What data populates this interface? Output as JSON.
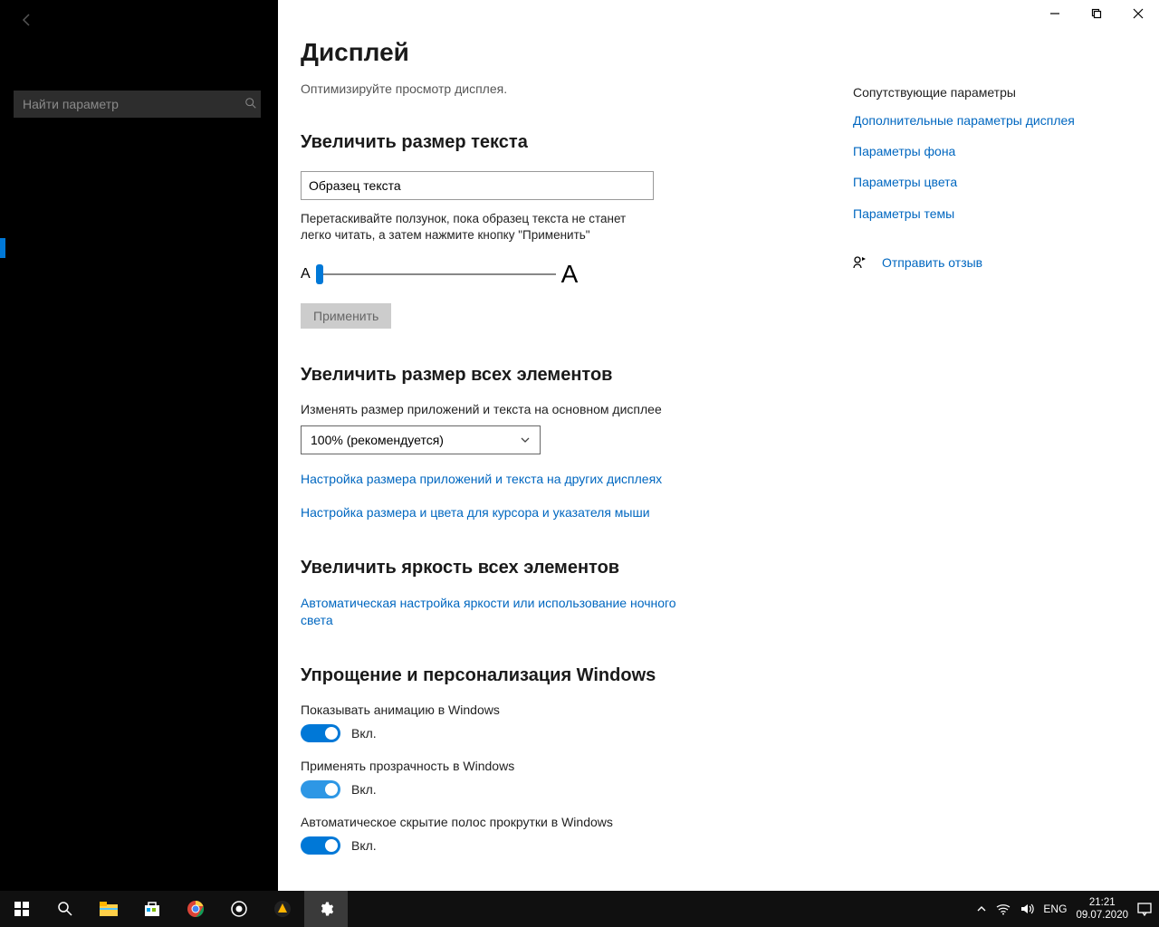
{
  "sidebar": {
    "search_placeholder": "Найти параметр"
  },
  "titlebar": {},
  "main": {
    "title": "Дисплей",
    "subtitle": "Оптимизируйте просмотр дисплея.",
    "section_text": {
      "heading": "Увеличить размер текста",
      "sample_value": "Образец текста",
      "slider_desc": "Перетаскивайте ползунок, пока образец текста не станет легко читать, а затем нажмите кнопку \"Применить\"",
      "apply_label": "Применить",
      "a_small": "A",
      "a_large": "A"
    },
    "section_elements": {
      "heading": "Увеличить размер всех элементов",
      "label": "Изменять размер приложений и текста на основном дисплее",
      "dropdown_value": "100% (рекомендуется)",
      "link1": "Настройка размера приложений и текста на других дисплеях",
      "link2": "Настройка размера и цвета для курсора и указателя мыши"
    },
    "section_bright": {
      "heading": "Увеличить яркость всех элементов",
      "link1": "Автоматическая настройка яркости или использование ночного света"
    },
    "section_simplify": {
      "heading": "Упрощение и персонализация Windows",
      "item1_label": "Показывать анимацию в Windows",
      "item1_state": "Вкл.",
      "item2_label": "Применять прозрачность в Windows",
      "item2_state": "Вкл.",
      "item3_label": "Автоматическое скрытие полос прокрутки в Windows",
      "item3_state": "Вкл."
    }
  },
  "right": {
    "heading": "Сопутствующие параметры",
    "links": [
      "Дополнительные параметры дисплея",
      "Параметры фона",
      "Параметры цвета",
      "Параметры темы"
    ],
    "feedback": "Отправить отзыв"
  },
  "taskbar": {
    "lang": "ENG",
    "time": "21:21",
    "date": "09.07.2020"
  }
}
